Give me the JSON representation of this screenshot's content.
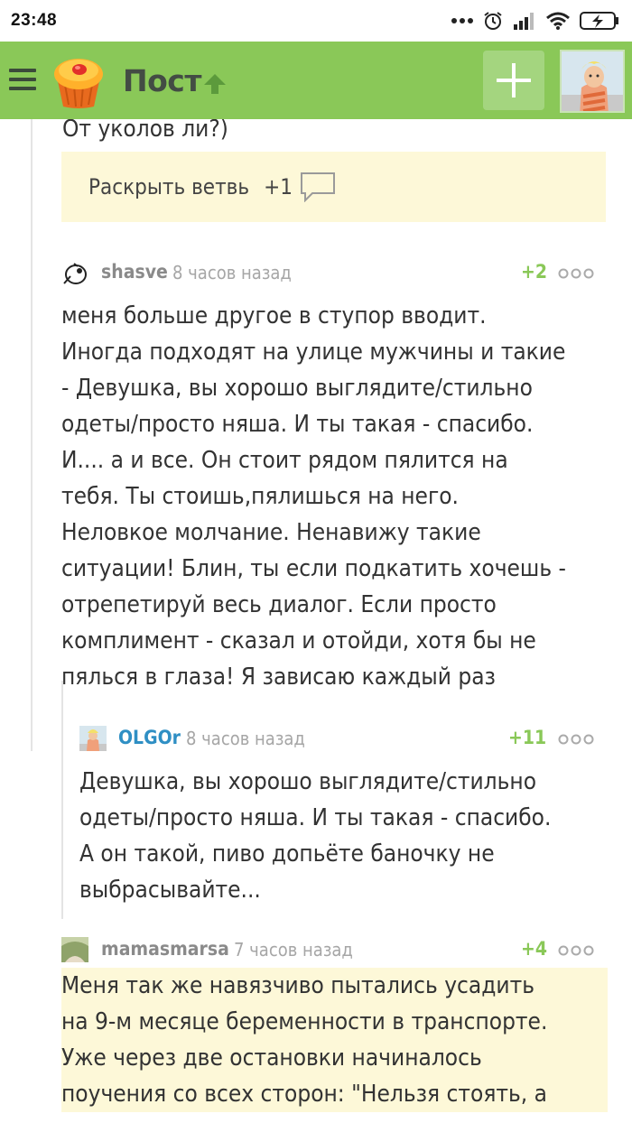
{
  "status_bar": {
    "time": "23:48"
  },
  "header": {
    "title": "Пост",
    "menu_icon": "hamburger-menu-icon",
    "logo_icon": "pikabu-cupcake-logo",
    "arrow_icon": "up-arrow-icon",
    "add_icon": "plus-icon",
    "brand_color": "#8ac858"
  },
  "thread": {
    "cut_text": "От уколов ли?)",
    "expand_label": "Раскрыть ветвь",
    "expand_count": "+1"
  },
  "comments": [
    {
      "author": "shasve",
      "time": "8 часов назад",
      "rating": "+2",
      "lines": [
        "меня больше другое в ступор вводит.",
        "Иногда подходят на улице мужчины и такие",
        "- Девушка, вы хорошо выглядите/стильно",
        "одеты/просто няша. И ты такая - спасибо.",
        "И.... а и все. Он стоит рядом пялится на",
        "тебя. Ты стоишь,пялишься на него.",
        "Неловкое молчание. Ненавижу такие",
        "ситуации! Блин, ты если подкатить хочешь -",
        "отрепетируй весь диалог. Если просто",
        "комплимент - сказал и отойди, хотя бы не",
        "пялься в глаза! Я зависаю каждый раз"
      ]
    },
    {
      "author": "OLGOr",
      "time": "8 часов назад",
      "rating": "+11",
      "lines": [
        "Девушка, вы хорошо выглядите/стильно",
        "одеты/просто няша. И ты такая - спасибо.",
        "А он такой, пиво допьёте баночку не",
        "выбрасывайте..."
      ]
    },
    {
      "author": "mamasmarsa",
      "time": "7 часов назад",
      "rating": "+4",
      "lines": [
        "Меня так же навязчиво пытались усадить",
        "на 9-м месяце беременности в транспорте.",
        "Уже через две остановки начиналось",
        "поучения со всех сторон: \"Нельзя стоять, а"
      ]
    }
  ]
}
